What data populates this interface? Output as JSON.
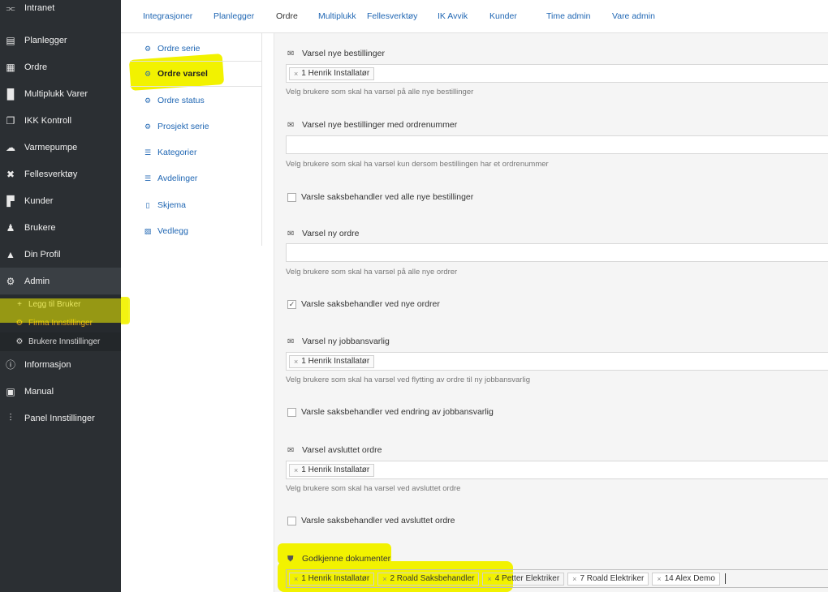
{
  "sidebar": {
    "items": [
      {
        "label": "Intranet",
        "icon": "share-icon"
      },
      {
        "label": "Planlegger",
        "icon": "calendar-icon"
      },
      {
        "label": "Ordre",
        "icon": "grid-icon"
      },
      {
        "label": "Multiplukk Varer",
        "icon": "barcode-icon"
      },
      {
        "label": "IKK Kontroll",
        "icon": "copy-icon"
      },
      {
        "label": "Varmepumpe",
        "icon": "cloud-icon"
      },
      {
        "label": "Fellesverktøy",
        "icon": "tools-icon"
      },
      {
        "label": "Kunder",
        "icon": "building-icon"
      },
      {
        "label": "Brukere",
        "icon": "users-icon"
      },
      {
        "label": "Din Profil",
        "icon": "user-icon"
      },
      {
        "label": "Admin",
        "icon": "gear-icon"
      }
    ],
    "sub_items": [
      {
        "label": "Legg til Bruker",
        "icon": "plus-icon"
      },
      {
        "label": "Firma Innstillinger",
        "icon": "gear-icon"
      },
      {
        "label": "Brukere Innstillinger",
        "icon": "gear-icon"
      }
    ],
    "bottom_items": [
      {
        "label": "Informasjon",
        "icon": "info-icon"
      },
      {
        "label": "Manual",
        "icon": "book-icon"
      },
      {
        "label": "Panel Innstillinger",
        "icon": "sliders-icon"
      }
    ]
  },
  "tabs": [
    "Integrasjoner",
    "Planlegger",
    "Ordre",
    "Multiplukk",
    "Fellesverktøy",
    "IK Avvik",
    "Kunder",
    "Time admin",
    "Vare admin"
  ],
  "active_tab": "Ordre",
  "subnav": [
    "Ordre serie",
    "Ordre varsel",
    "Ordre status",
    "Prosjekt serie",
    "Kategorier",
    "Avdelinger",
    "Skjema",
    "Vedlegg"
  ],
  "form": {
    "s1_label": "Varsel nye bestillinger",
    "s1_tag": "1 Henrik Installatør",
    "s1_help": "Velg brukere som skal ha varsel på alle nye bestillinger",
    "s2_label": "Varsel nye bestillinger med ordrenummer",
    "s2_help": "Velg brukere som skal ha varsel kun dersom bestillingen har et ordrenummer",
    "c1_label": "Varsle saksbehandler ved alle nye bestillinger",
    "s3_label": "Varsel ny ordre",
    "s3_help": "Velg brukere som skal ha varsel på alle nye ordrer",
    "c2_label": "Varsle saksbehandler ved nye ordrer",
    "s4_label": "Varsel ny jobbansvarlig",
    "s4_tag": "1 Henrik Installatør",
    "s4_help": "Velg brukere som skal ha varsel ved flytting av ordre til ny jobbansvarlig",
    "c3_label": "Varsle saksbehandler ved endring av jobbansvarlig",
    "s5_label": "Varsel avsluttet ordre",
    "s5_tag": "1 Henrik Installatør",
    "s5_help": "Velg brukere som skal ha varsel ved avsluttet ordre",
    "c4_label": "Varsle saksbehandler ved avsluttet ordre",
    "s6_label": "Godkjenne dokumenter",
    "s6_tags": [
      "1 Henrik Installatør",
      "2 Roald Saksbehandler",
      "4 Petter Elektriker",
      "7 Roald Elektriker",
      "14 Alex Demo"
    ]
  },
  "colors": {
    "sidebar_bg": "#2b2f33",
    "link": "#1f66b3",
    "highlight": "#f2f200",
    "accent": "#e8a817"
  }
}
